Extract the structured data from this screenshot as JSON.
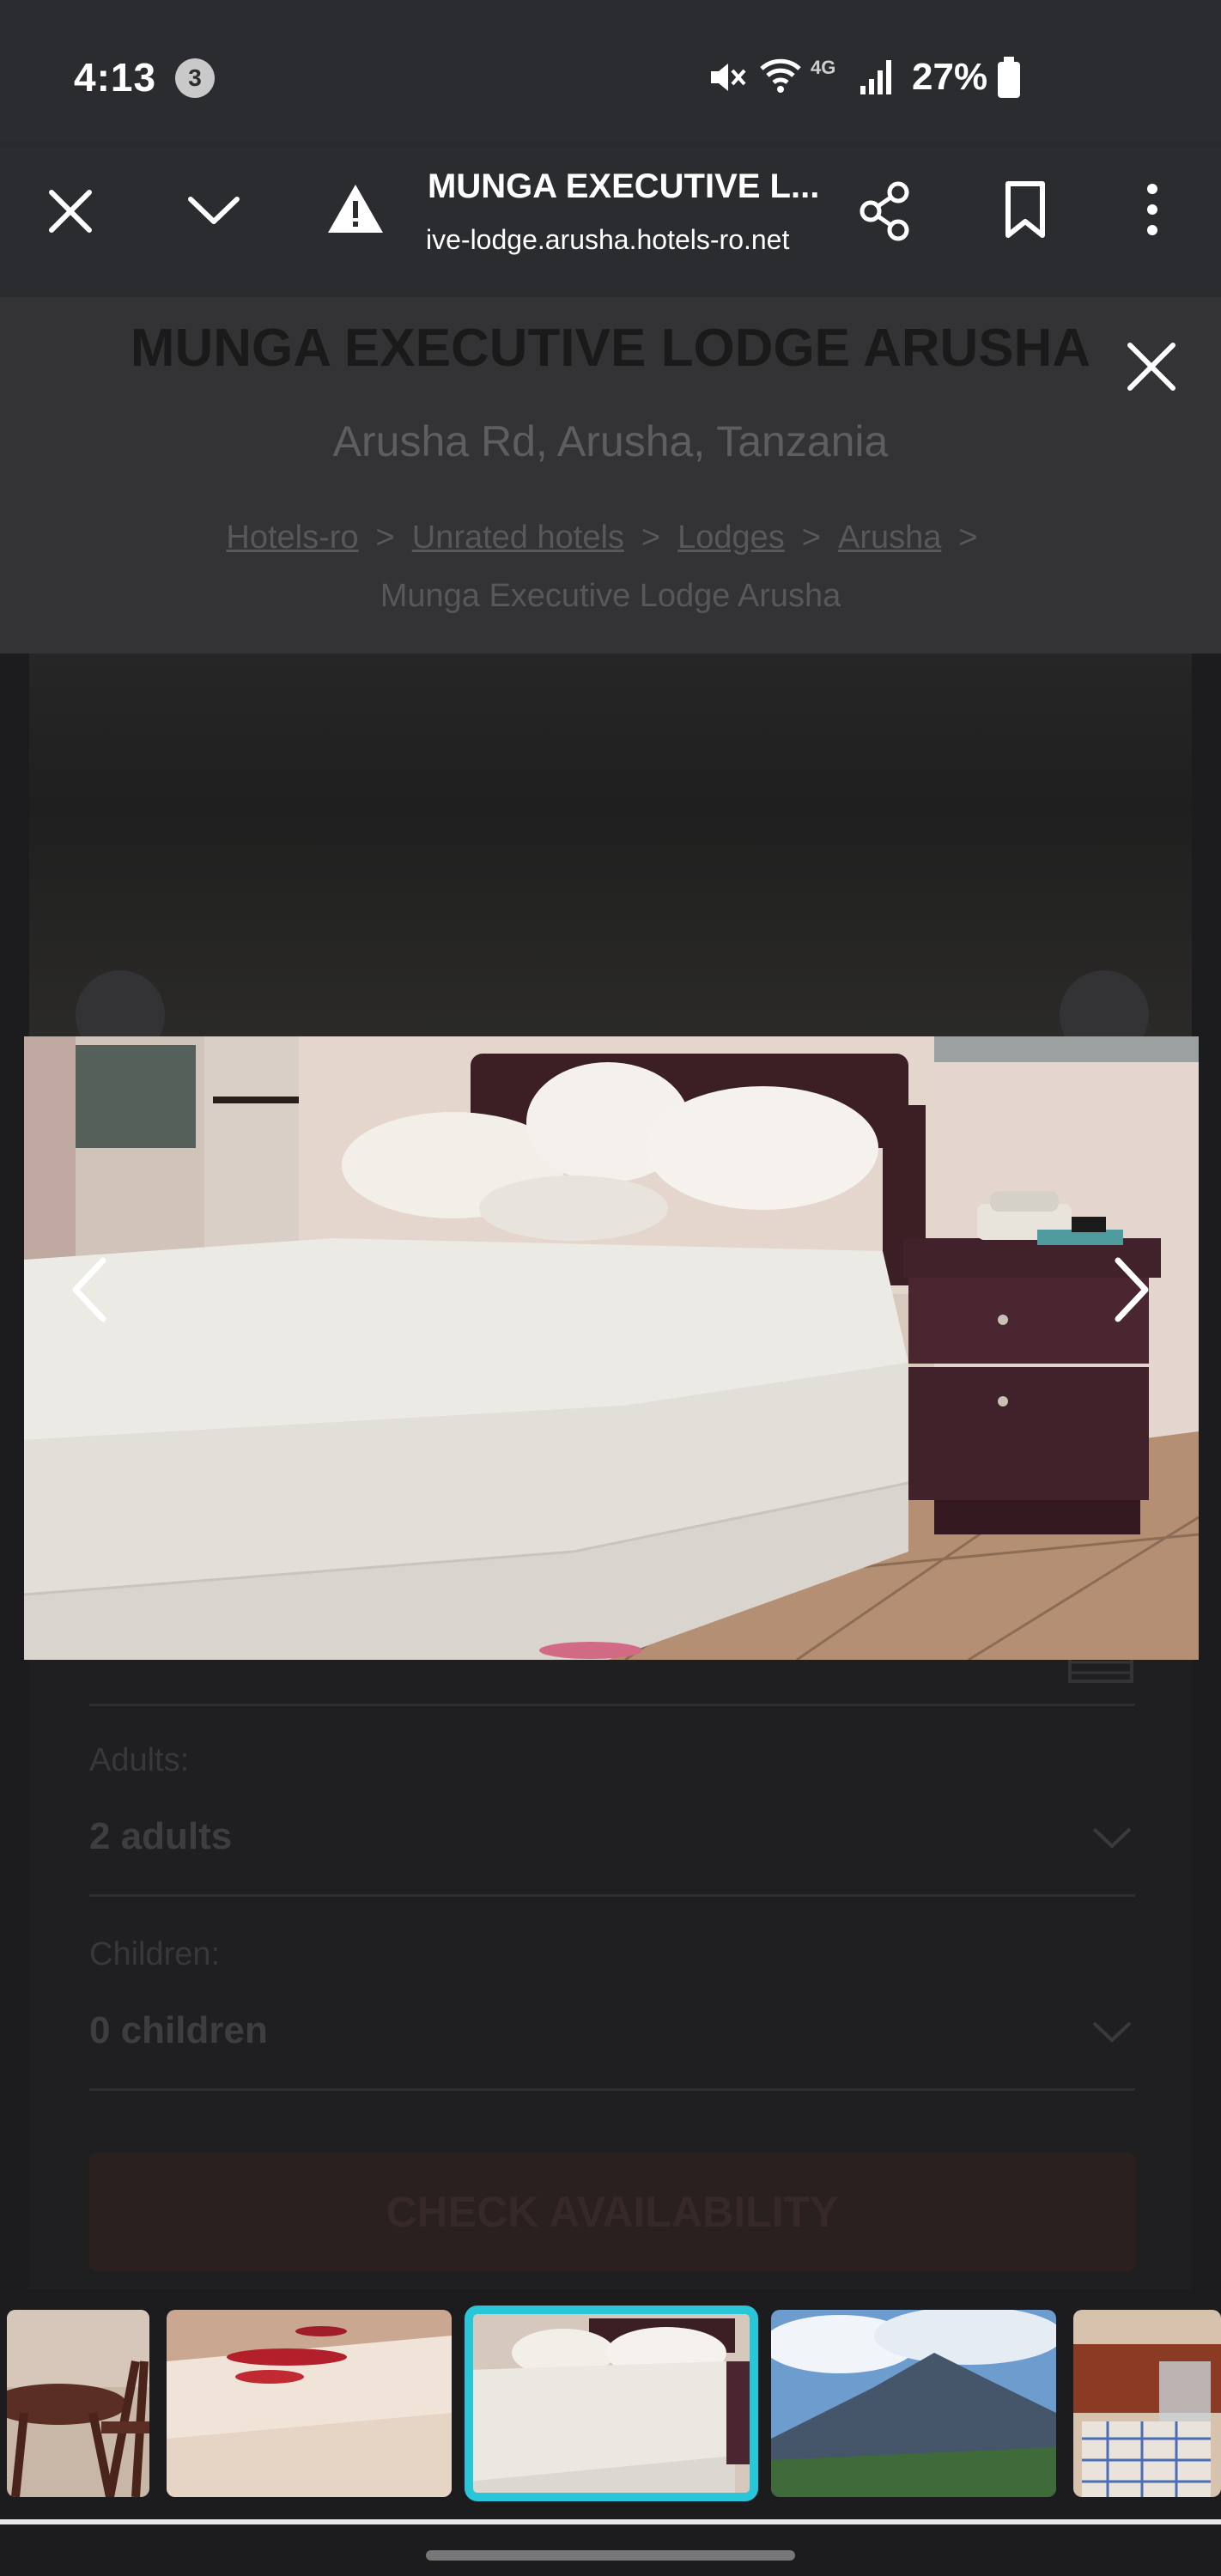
{
  "status_bar": {
    "time": "4:13",
    "notification_count": "3",
    "battery": "27%",
    "network": "4G",
    "icons": [
      "mute-icon",
      "wifi-icon",
      "signal-icon",
      "battery-icon"
    ]
  },
  "browser": {
    "tab_title": "MUNGA EXECUTIVE L...",
    "url": "ive-lodge.arusha.hotels-ro.net",
    "icons": [
      "close-icon",
      "chevron-down-icon",
      "warning-icon",
      "share-icon",
      "bookmark-icon",
      "more-icon"
    ]
  },
  "page": {
    "hotel_name": "MUNGA EXECUTIVE LODGE ARUSHA",
    "address": "Arusha Rd, Arusha, Tanzania",
    "breadcrumb": [
      "Hotels-ro",
      "Unrated hotels",
      "Lodges",
      "Arusha"
    ],
    "breadcrumb_current": "Munga Executive Lodge Arusha",
    "breadcrumb_separator": ">",
    "adults_label": "Adults:",
    "adults_value": "2 adults",
    "children_label": "Children:",
    "children_value": "0 children",
    "check_button": "CHECK AVAILABILITY"
  },
  "lightbox": {
    "icons": [
      "close-icon",
      "chevron-left-icon",
      "chevron-right-icon"
    ],
    "selected_thumbnail": 3,
    "thumbnail_count": 5
  },
  "colors": {
    "toolbar": "#2b2c30",
    "overlay_page": "#1f1f21",
    "thumbnail_highlight": "#29c5d8",
    "check_button_dimmed": "#2a201d"
  }
}
